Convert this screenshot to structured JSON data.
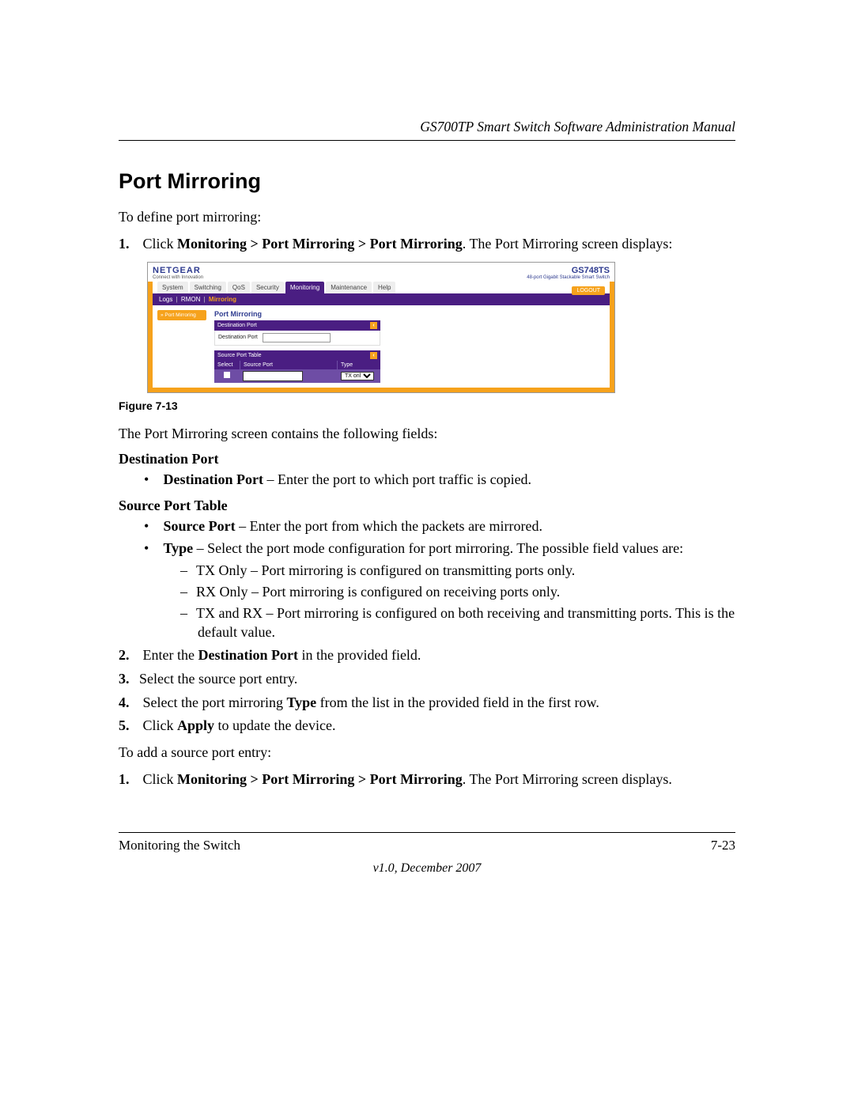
{
  "header": {
    "manual_title": "GS700TP Smart Switch Software Administration Manual"
  },
  "title": "Port Mirroring",
  "intro": "To define port mirroring:",
  "step1_pre": "Click ",
  "step1_path": "Monitoring > Port Mirroring > Port Mirroring",
  "step1_post": ". The Port Mirroring screen displays:",
  "screenshot": {
    "logo": "NETGEAR",
    "logo_sub": "Connect with Innovation",
    "model": "GS748TS",
    "model_desc": "48-port Gigabit Stackable Smart Switch",
    "tabs": {
      "system": "System",
      "switching": "Switching",
      "qos": "QoS",
      "security": "Security",
      "monitoring": "Monitoring",
      "maintenance": "Maintenance",
      "help": "Help"
    },
    "logout": "LOGOUT",
    "subnav": {
      "logs": "Logs",
      "rmon": "RMON",
      "mirroring": "Mirroring"
    },
    "sidebar_item": "» Port Mirroring",
    "panel_title": "Port Mirroring",
    "dest_header": "Destination Port",
    "dest_label": "Destination Port",
    "src_header": "Source Port Table",
    "col_select": "Select",
    "col_source": "Source Port",
    "col_type": "Type",
    "type_option": "TX only"
  },
  "figure_caption": "Figure 7-13",
  "after_figure": "The Port Mirroring screen contains the following fields:",
  "sections": {
    "dest_head": "Destination Port",
    "dest_bullet_bold": "Destination Port",
    "dest_bullet_rest": " – Enter the port to which port traffic is copied.",
    "src_head": "Source Port Table",
    "src_b1_bold": "Source Port",
    "src_b1_rest": " – Enter the port from which the packets are mirrored.",
    "src_b2_bold": "Type",
    "src_b2_rest": " – Select the port mode configuration for port mirroring. The possible field values are:",
    "dash1": "TX Only – Port mirroring is configured on transmitting ports only.",
    "dash2": "RX Only – Port mirroring is configured on receiving ports only.",
    "dash3": "TX and RX – Port mirroring is configured on both receiving and transmitting ports. This is the default value."
  },
  "step2_pre": "Enter the ",
  "step2_bold": "Destination Port",
  "step2_post": " in the provided field.",
  "step3": "Select the source port entry.",
  "step4_pre": "Select the port mirroring ",
  "step4_bold": "Type",
  "step4_post": " from the list in the provided field in the first row.",
  "step5_pre": "Click ",
  "step5_bold": "Apply",
  "step5_post": " to update the device.",
  "add_intro": "To add a source port entry:",
  "add_step1_pre": "Click ",
  "add_step1_bold": "Monitoring > Port Mirroring > Port Mirroring",
  "add_step1_post": ". The Port Mirroring screen displays.",
  "footer": {
    "left": "Monitoring the Switch",
    "right": "7-23",
    "version": "v1.0, December 2007"
  }
}
